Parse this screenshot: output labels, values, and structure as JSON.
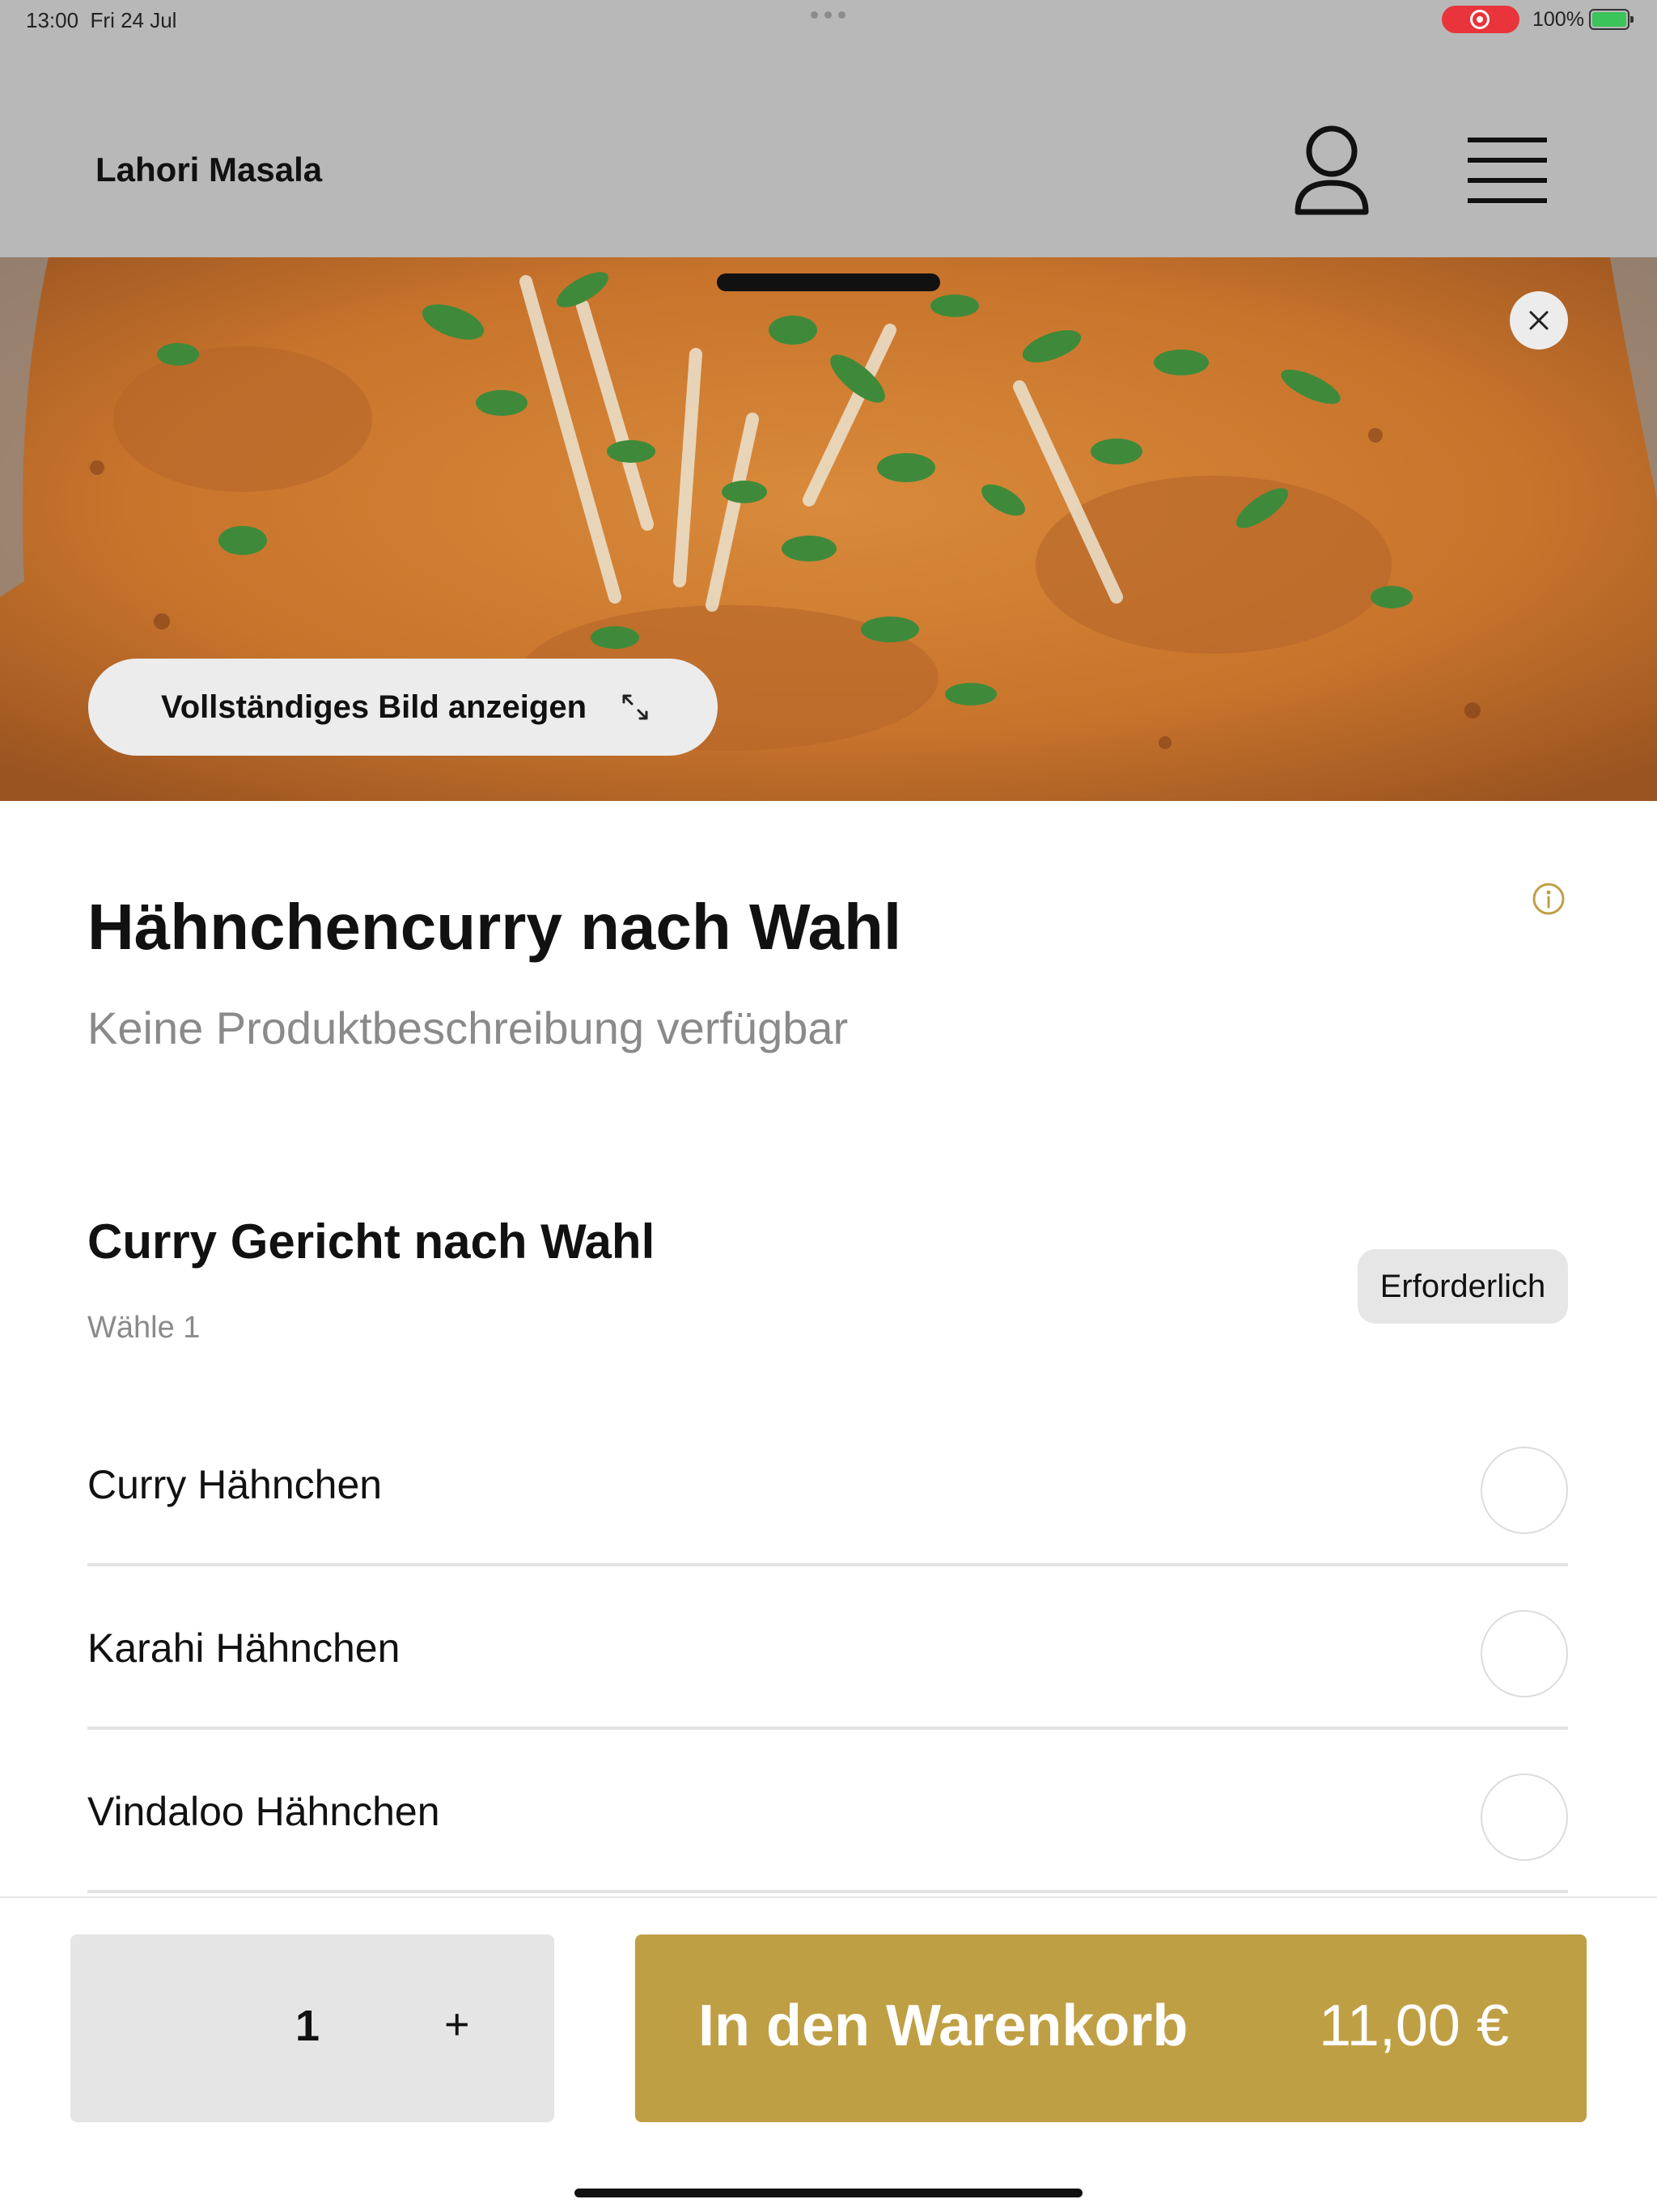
{
  "status_bar": {
    "time": "13:00",
    "date": "Fri 24 Jul",
    "battery_percent": "100%",
    "battery_level": 1.0,
    "recording": true,
    "colors": {
      "recording": "#e8343a",
      "battery": "#3ac45a"
    }
  },
  "header": {
    "brand": "Lahori Masala",
    "icons": [
      "user-icon",
      "hamburger-menu-icon"
    ]
  },
  "hero": {
    "close_icon": "close-icon",
    "view_full_image_label": "Vollständiges Bild anzeigen",
    "expand_icon": "expand-icon"
  },
  "product": {
    "title": "Hähnchencurry nach Wahl",
    "description": "Keine Produktbeschreibung verfügbar",
    "info_icon": "info-icon"
  },
  "option_group": {
    "title": "Curry Gericht nach Wahl",
    "subtitle": "Wähle 1",
    "badge": "Erforderlich",
    "options": [
      {
        "label": "Curry Hähnchen",
        "selected": false
      },
      {
        "label": "Karahi Hähnchen",
        "selected": false
      },
      {
        "label": "Vindaloo Hähnchen",
        "selected": false
      }
    ]
  },
  "footer": {
    "quantity": "1",
    "plus_label": "+",
    "add_to_cart_label": "In den Warenkorb",
    "price": "11,00 €",
    "colors": {
      "accent": "#bf9f44"
    }
  }
}
